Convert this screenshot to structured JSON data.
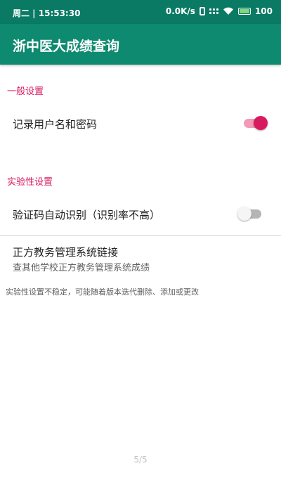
{
  "status_bar": {
    "time": "周二 | 15:53:30",
    "network_speed": "0.0K/s",
    "battery_level": "100",
    "battery_fraction": 1.0
  },
  "app_bar": {
    "title": "浙中医大成绩查询"
  },
  "settings": {
    "general_category": "一般设置",
    "remember_credentials": {
      "title": "记录用户名和密码",
      "enabled": true
    },
    "experimental_category": "实验性设置",
    "captcha_recognition": {
      "title": "验证码自动识别（识别率不高）",
      "enabled": false
    },
    "zhengfang_link": {
      "title": "正方教务管理系统链接",
      "summary": "查其他学校正方教务管理系统成绩"
    },
    "footnote": "实验性设置不稳定，可能随着版本迭代删除、添加或更改"
  },
  "page_indicator": "5/5",
  "colors": {
    "status_bar": "#0a7a64",
    "app_bar": "#0d8a6f",
    "accent": "#d81b60"
  }
}
